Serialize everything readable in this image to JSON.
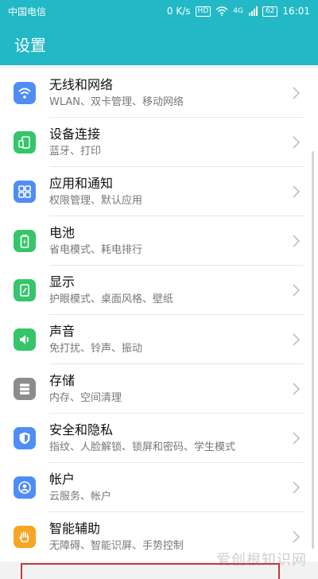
{
  "status_bar": {
    "carrier": "中国电信",
    "net_speed": "0 K/s",
    "hd_badge": "HD",
    "signal": "4G",
    "battery": "62",
    "time": "16:01"
  },
  "app_bar": {
    "title": "设置"
  },
  "items": [
    {
      "title": "无线和网络",
      "subtitle": "WLAN、双卡管理、移动网络",
      "icon": "wifi-icon",
      "color": "#4f8df5"
    },
    {
      "title": "设备连接",
      "subtitle": "蓝牙、打印",
      "icon": "device-connect-icon",
      "color": "#35c56a"
    },
    {
      "title": "应用和通知",
      "subtitle": "权限管理、默认应用",
      "icon": "apps-icon",
      "color": "#4f8df5"
    },
    {
      "title": "电池",
      "subtitle": "省电模式、耗电排行",
      "icon": "battery-icon",
      "color": "#35c56a"
    },
    {
      "title": "显示",
      "subtitle": "护眼模式、桌面风格、壁纸",
      "icon": "display-icon",
      "color": "#35c56a"
    },
    {
      "title": "声音",
      "subtitle": "免打扰、铃声、振动",
      "icon": "sound-icon",
      "color": "#35c56a"
    },
    {
      "title": "存储",
      "subtitle": "内存、空间清理",
      "icon": "storage-icon",
      "color": "#8c8c8c"
    },
    {
      "title": "安全和隐私",
      "subtitle": "指纹、人脸解锁、锁屏和密码、学生模式",
      "icon": "shield-icon",
      "color": "#4f8df5"
    },
    {
      "title": "帐户",
      "subtitle": "云服务、帐户",
      "icon": "account-icon",
      "color": "#4f8df5"
    },
    {
      "title": "智能辅助",
      "subtitle": "无障碍、智能识屏、手势控制",
      "icon": "hand-icon",
      "color": "#f5a623"
    }
  ],
  "watermark": "爱创根知识网"
}
